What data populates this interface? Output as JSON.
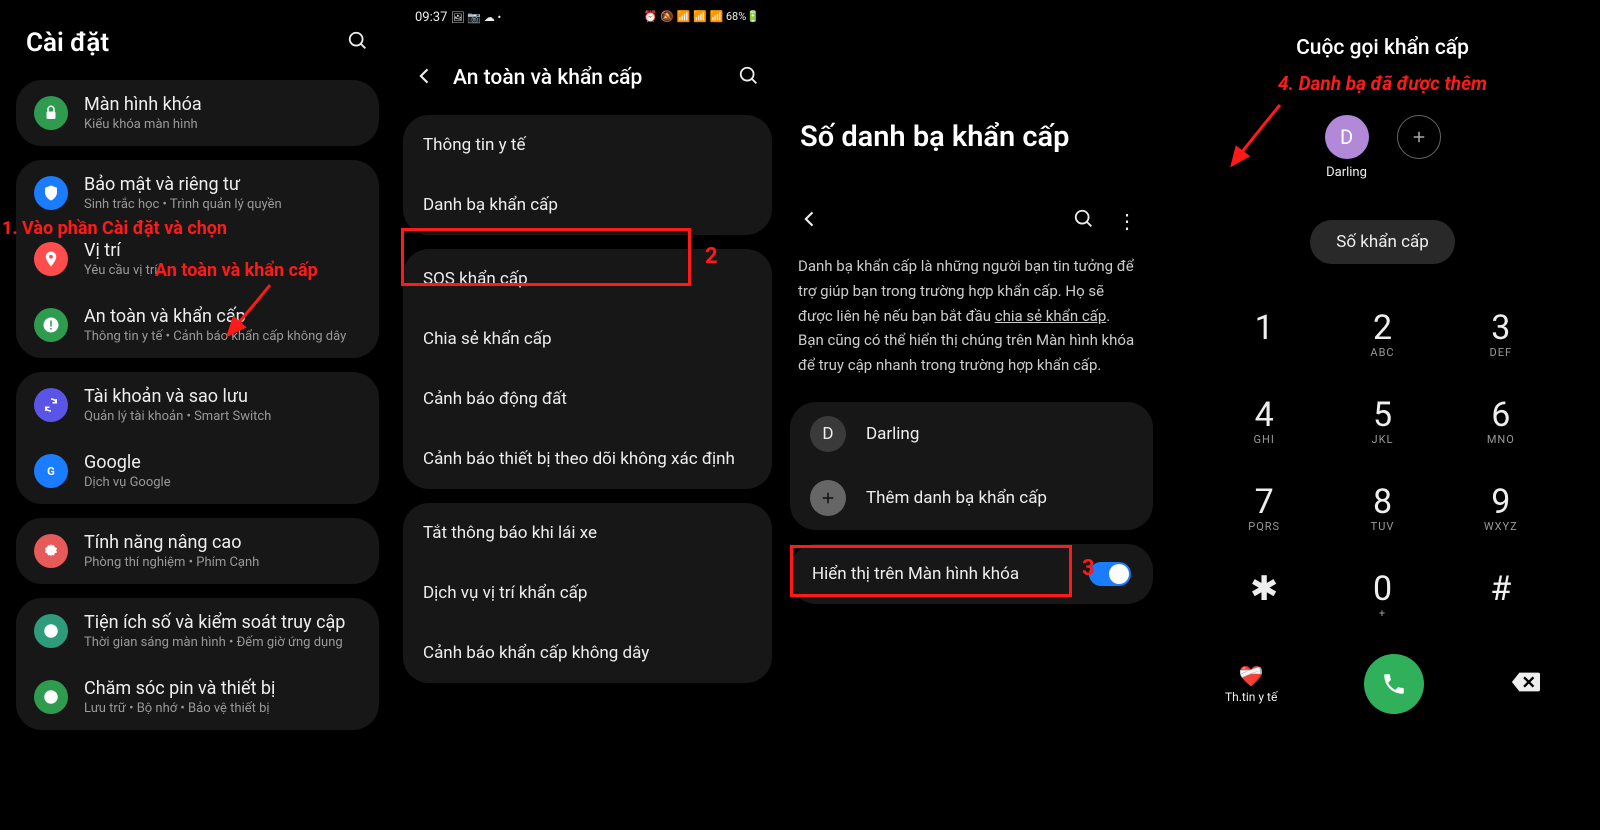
{
  "panel1": {
    "title": "Cài đặt",
    "annotation_line1": "1. Vào phần Cài đặt và chọn",
    "annotation_line2": "An toàn và khẩn cấp",
    "groups": [
      [
        {
          "title": "Màn hình khóa",
          "sub": "Kiểu khóa màn hình",
          "icon": "lock",
          "bg": "#2e9b4f"
        }
      ],
      [
        {
          "title": "Bảo mật và riêng tư",
          "sub": "Sinh trắc học • Trình quản lý quyền",
          "icon": "shield",
          "bg": "#1a7cff"
        },
        {
          "title": "Vị trí",
          "sub": "Yêu cầu vị trí",
          "icon": "pin",
          "bg": "#ff4d4d"
        },
        {
          "title": "An toàn và khẩn cấp",
          "sub": "Thông tin y tế • Cảnh báo khẩn cấp không dây",
          "icon": "sos",
          "bg": "#2e9b4f"
        }
      ],
      [
        {
          "title": "Tài khoản và sao lưu",
          "sub": "Quản lý tài khoản • Smart Switch",
          "icon": "sync",
          "bg": "#5a55e6"
        },
        {
          "title": "Google",
          "sub": "Dịch vụ Google",
          "icon": "google",
          "bg": "#1a7cff"
        }
      ],
      [
        {
          "title": "Tính năng nâng cao",
          "sub": "Phòng thí nghiệm • Phím Cạnh",
          "icon": "gear",
          "bg": "#e65a5a"
        }
      ],
      [
        {
          "title": "Tiện ích số và kiểm soát truy cập",
          "sub": "Thời gian sáng màn hình • Đếm giờ ứng dụng",
          "icon": "wellbeing",
          "bg": "#2e9b7a"
        },
        {
          "title": "Chăm sóc pin và thiết bị",
          "sub": "Lưu trữ • Bộ nhớ • Bảo vệ thiết bị",
          "icon": "battery",
          "bg": "#2e9b4f"
        }
      ]
    ]
  },
  "panel2": {
    "status_time": "09:37",
    "status_icons": "🖼 📷 ☁ •",
    "status_right": "⏰ 🔕 📶 📶 📶 68%🔋",
    "title": "An toàn và khẩn cấp",
    "annotation_num": "2",
    "groups": [
      [
        "Thông tin y tế",
        "Danh bạ khẩn cấp"
      ],
      [
        "SOS khẩn cấp",
        "Chia sẻ khẩn cấp",
        "Cảnh báo động đất",
        "Cảnh báo thiết bị theo dõi không xác định"
      ],
      [
        "Tắt thông báo khi lái xe",
        "Dịch vụ vị trí khẩn cấp",
        "Cảnh báo khẩn cấp không dây"
      ]
    ]
  },
  "panel3": {
    "title": "Số danh bạ khẩn cấp",
    "desc_before": "Danh bạ khẩn cấp là những người bạn tin tưởng để trợ giúp bạn trong trường hợp khẩn cấp. Họ sẽ được liên hệ nếu bạn bắt đầu ",
    "desc_underline": "chia sẻ khẩn cấp",
    "desc_after": ". Bạn cũng có thể hiển thị chúng trên Màn hình khóa để truy cập nhanh trong trường hợp khẩn cấp.",
    "contact_initial": "D",
    "contact_name": "Darling",
    "add_label": "Thêm danh bạ khẩn cấp",
    "annotation_num": "3",
    "toggle_label": "Hiển thị trên Màn hình khóa"
  },
  "panel4": {
    "title": "Cuộc gọi khẩn cấp",
    "annotation": "4. Danh bạ đã được thêm",
    "contact_initial": "D",
    "contact_name": "Darling",
    "pill": "Số khẩn cấp",
    "keys": [
      {
        "n": "1",
        "s": ""
      },
      {
        "n": "2",
        "s": "ABC"
      },
      {
        "n": "3",
        "s": "DEF"
      },
      {
        "n": "4",
        "s": "GHI"
      },
      {
        "n": "5",
        "s": "JKL"
      },
      {
        "n": "6",
        "s": "MNO"
      },
      {
        "n": "7",
        "s": "PQRS"
      },
      {
        "n": "8",
        "s": "TUV"
      },
      {
        "n": "9",
        "s": "WXYZ"
      },
      {
        "n": "✱",
        "s": ""
      },
      {
        "n": "0",
        "s": "+"
      },
      {
        "n": "#",
        "s": ""
      }
    ],
    "med_label": "Th.tin y tế"
  }
}
